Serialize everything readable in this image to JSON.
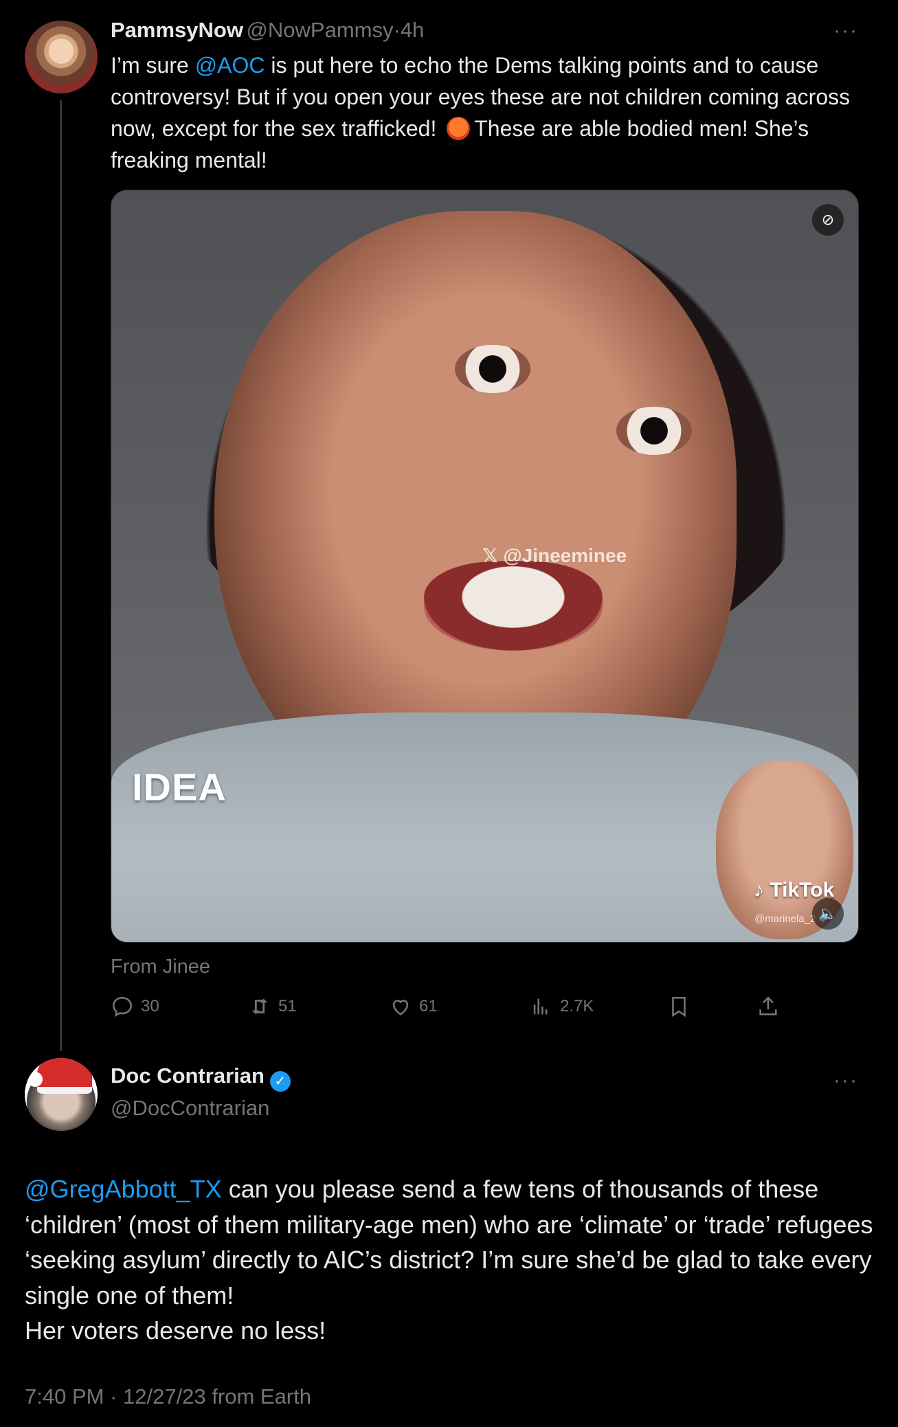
{
  "parent_tweet": {
    "display_name": "PammsyNow",
    "handle": "@NowPammsy",
    "separator": "·",
    "age": "4h",
    "more": "···",
    "text_pre": "I’m sure ",
    "mention": "@AOC",
    "text_mid": " is put here to echo the Dems talking points and to cause controversy! But if you open your eyes these are not children coming across now, except for the sex trafficked! ",
    "text_post": "These are able bodied men! She’s freaking mental!",
    "emoji": "face-with-symbols-on-mouth",
    "media": {
      "watermark": "@Jineeminee",
      "caption": "IDEA",
      "tiktok_label": "TikTok",
      "tiktok_handle": "@marinela_2"
    },
    "from_label": "From Jinee",
    "stats": {
      "replies": "30",
      "reposts": "51",
      "likes": "61",
      "views": "2.7K"
    }
  },
  "main_tweet": {
    "display_name": "Doc Contrarian",
    "handle": "@DocContrarian",
    "more": "···",
    "mention": "@GregAbbott_TX",
    "line1_rest": " can you please send a few tens of thousands of these ‘children’ (most of them military-age men) who are ‘climate’ or ‘trade’ refugees ‘seeking asylum’ directly to AIC’s district? I’m sure she’d be glad to take every single one of them!",
    "line2": "Her voters deserve no less!",
    "timestamp": "7:40 PM · 12/27/23 from Earth"
  },
  "colors": {
    "background": "#000000",
    "text": "#e7e9ea",
    "muted": "#71767b",
    "accent": "#1d9bf0"
  }
}
